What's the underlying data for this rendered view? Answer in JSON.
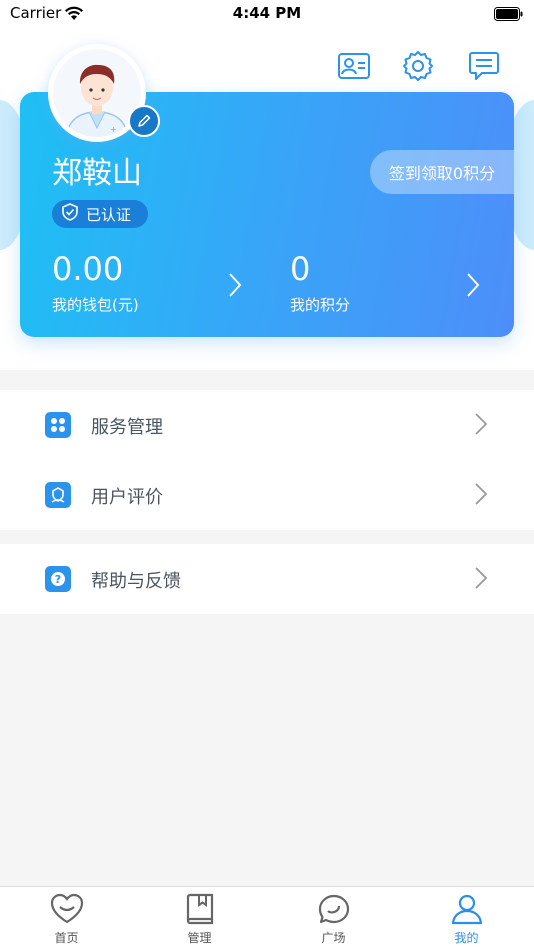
{
  "status_bar": {
    "carrier": "Carrier",
    "time": "4:44 PM"
  },
  "header": {
    "icons": [
      "id-card-icon",
      "settings-gear-icon",
      "message-icon"
    ]
  },
  "profile": {
    "name": "郑鞍山",
    "verified_label": "已认证",
    "signin_label": "签到领取0积分",
    "wallet": {
      "value": "0.00",
      "label": "我的钱包(元)"
    },
    "points": {
      "value": "0",
      "label": "我的积分"
    }
  },
  "menu": {
    "items": [
      {
        "label": "服务管理",
        "icon": "service-grid-icon"
      },
      {
        "label": "用户评价",
        "icon": "rating-icon"
      },
      {
        "label": "帮助与反馈",
        "icon": "help-icon"
      }
    ]
  },
  "tab_bar": {
    "tabs": [
      {
        "label": "首页",
        "icon": "home-heart-icon"
      },
      {
        "label": "管理",
        "icon": "book-icon"
      },
      {
        "label": "广场",
        "icon": "chat-bubble-icon"
      },
      {
        "label": "我的",
        "icon": "person-icon"
      }
    ],
    "active": "我的"
  },
  "colors": {
    "accent": "#2b8fe8",
    "card_start": "#1ec0f4",
    "card_end": "#4d8ef9",
    "badge": "#1a7fd9",
    "background": "#f5f5f5"
  }
}
